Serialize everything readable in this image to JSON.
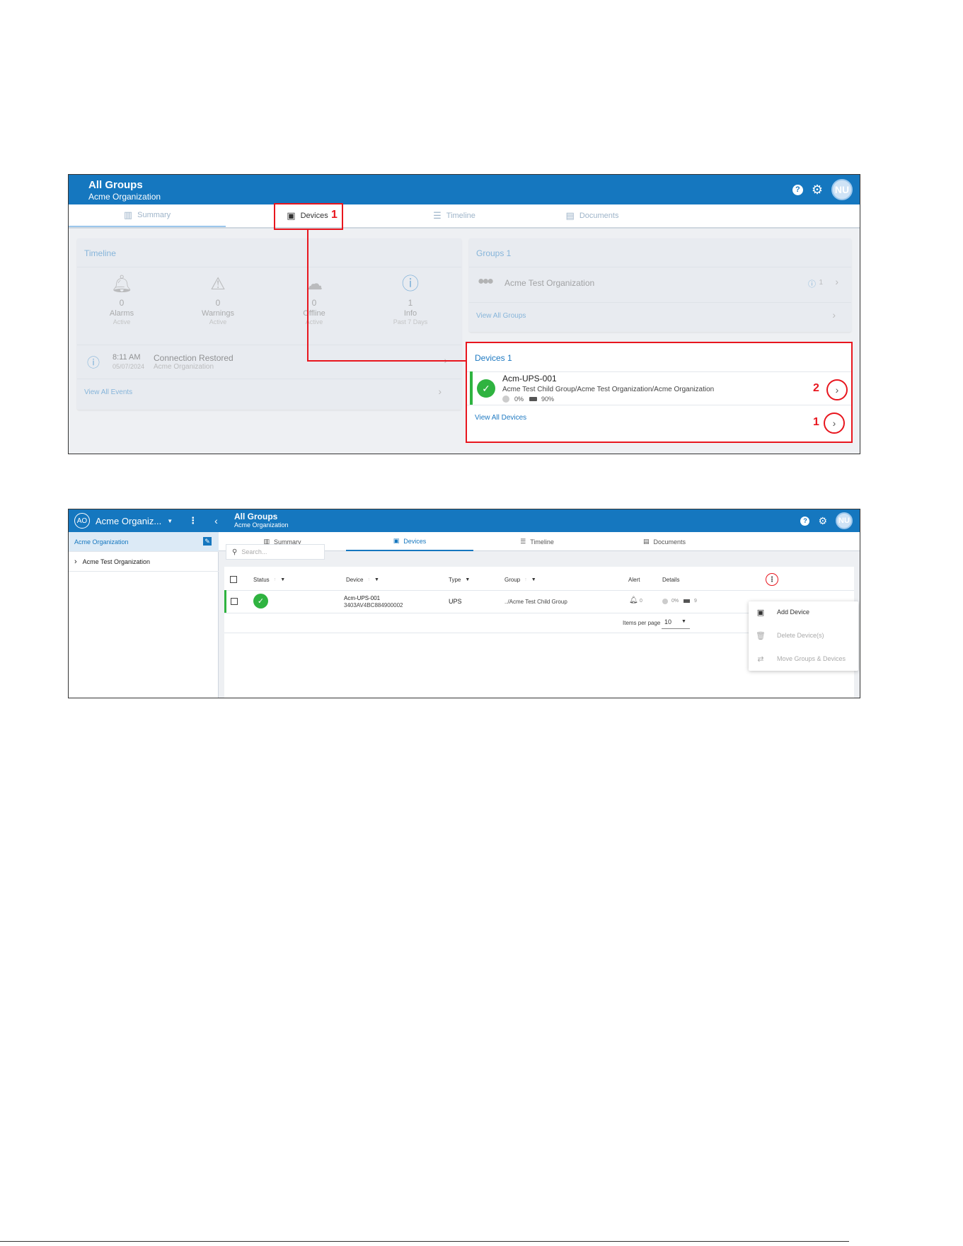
{
  "screen1": {
    "header": {
      "title": "All Groups",
      "subtitle": "Acme Organization",
      "help_icon": "?",
      "settings_icon": "gear-icon",
      "avatar": "NU"
    },
    "tabs": [
      {
        "label": "Summary",
        "icon": "bar-chart-icon"
      },
      {
        "label": "Devices",
        "icon": "device-icon"
      },
      {
        "label": "Timeline",
        "icon": "list-icon"
      },
      {
        "label": "Documents",
        "icon": "document-icon"
      }
    ],
    "timeline": {
      "title": "Timeline",
      "stats": [
        {
          "count": "0",
          "label": "Alarms",
          "sub": "Active",
          "icon": "bell-icon"
        },
        {
          "count": "0",
          "label": "Warnings",
          "sub": "Active",
          "icon": "warning-icon"
        },
        {
          "count": "0",
          "label": "Offline",
          "sub": "Active",
          "icon": "cloud-off-icon"
        },
        {
          "count": "1",
          "label": "Info",
          "sub": "Past 7 Days",
          "icon": "info-icon"
        }
      ],
      "event": {
        "time": "8:11 AM",
        "date": "05/07/2024",
        "title": "Connection Restored",
        "org": "Acme Organization"
      },
      "view_all": "View All Events"
    },
    "groups": {
      "title": "Groups 1",
      "item": {
        "name": "Acme Test Organization",
        "info_count": "1"
      },
      "view_all": "View All Groups"
    },
    "devices": {
      "title": "Devices 1",
      "item": {
        "name": "Acm-UPS-001",
        "path": "Acme Test Child Group/Acme Test Organization/Acme Organization",
        "load": "0%",
        "battery": "90%"
      },
      "view_all": "View All Devices"
    },
    "callouts": {
      "tab_devices": "1",
      "device_row": "2",
      "view_all": "1"
    },
    "accent": "#1577bf",
    "callout_color": "#e8161e"
  },
  "screen2": {
    "sidebar": {
      "org_initials": "AO",
      "org_name": "Acme Organiz...",
      "items": [
        {
          "label": "Acme Organization"
        },
        {
          "label": "Acme Test Organization"
        }
      ]
    },
    "header": {
      "title": "All Groups",
      "subtitle": "Acme Organization",
      "help_icon": "?",
      "avatar": "NU"
    },
    "tabs": [
      {
        "label": "Summary"
      },
      {
        "label": "Devices"
      },
      {
        "label": "Timeline"
      },
      {
        "label": "Documents"
      }
    ],
    "search_placeholder": "Search...",
    "table": {
      "headers": {
        "status": "Status",
        "device": "Device",
        "type": "Type",
        "group": "Group",
        "alert": "Alert",
        "details": "Details"
      },
      "row": {
        "device_name": "Acm-UPS-001",
        "serial": "3403AV4BC884900002",
        "type": "UPS",
        "group": "../Acme Test Child Group",
        "alert_count": "0",
        "load": "0%",
        "battery_partial": "9"
      },
      "items_per_page_label": "Items per page",
      "items_per_page_value": "10"
    },
    "menu": {
      "items": [
        {
          "label": "Add Device",
          "enabled": true
        },
        {
          "label": "Delete Device(s)",
          "enabled": false
        },
        {
          "label": "Move Groups & Devices",
          "enabled": false
        }
      ]
    }
  }
}
